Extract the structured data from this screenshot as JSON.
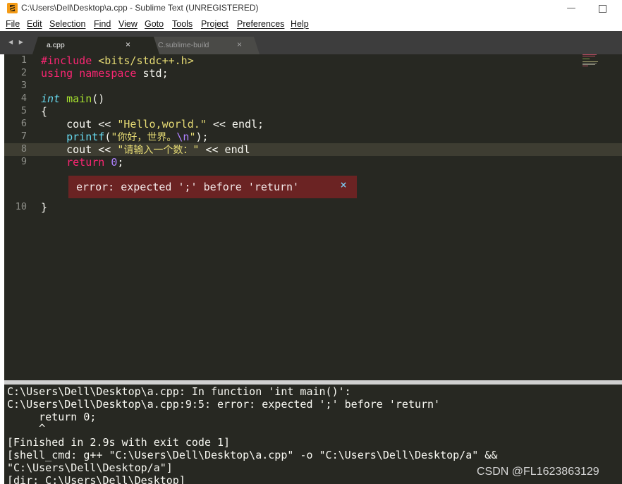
{
  "window": {
    "title": "C:\\Users\\Dell\\Desktop\\a.cpp - Sublime Text (UNREGISTERED)",
    "minimize_glyph": "—"
  },
  "menu": [
    "File",
    "Edit",
    "Selection",
    "Find",
    "View",
    "Goto",
    "Tools",
    "Project",
    "Preferences",
    "Help"
  ],
  "tabs": [
    {
      "label": "a.cpp",
      "active": true,
      "close": "×"
    },
    {
      "label": "C.sublime-build",
      "active": false,
      "close": "×"
    }
  ],
  "nav_arrows": "◀ ▶",
  "editor": {
    "line_numbers": [
      "1",
      "2",
      "3",
      "4",
      "5",
      "6",
      "7",
      "8",
      "9",
      "10"
    ],
    "highlighted_line": "8",
    "code": {
      "l1_directive": "#include",
      "l1_header": "<bits/stdc++.h>",
      "l2_using": "using",
      "l2_namespace": "namespace",
      "l2_rest": " std;",
      "l4_type": "int",
      "l4_fn": "main",
      "l4_rest": "()",
      "l5": "{",
      "l6_cout": "    cout << ",
      "l6_str": "\"Hello,world.\"",
      "l6_rest": " << endl;",
      "l7_indent": "    ",
      "l7_fn": "printf",
      "l7_open": "(",
      "l7_str_open": "\"",
      "l7_cjk": "你好，世界。",
      "l7_esc": "\\n",
      "l7_str_close": "\"",
      "l7_rest": ");",
      "l8_cout": "    cout << ",
      "l8_quote": "\"",
      "l8_cjk": "请输入一个数：",
      "l8_quote_close": "\"",
      "l8_rest": " << endl",
      "l9_indent": "    ",
      "l9_kw": "return",
      "l9_space": " ",
      "l9_num": "0",
      "l9_semi": ";",
      "l10": "}"
    },
    "error_message": "error: expected ';' before 'return'",
    "error_close": "×"
  },
  "console": {
    "lines": [
      "C:\\Users\\Dell\\Desktop\\a.cpp: In function 'int main()':",
      "C:\\Users\\Dell\\Desktop\\a.cpp:9:5: error: expected ';' before 'return'",
      "     return 0;",
      "     ^",
      "[Finished in 2.9s with exit code 1]",
      "[shell_cmd: g++ \"C:\\Users\\Dell\\Desktop\\a.cpp\" -o \"C:\\Users\\Dell\\Desktop/a\" &&",
      "\"C:\\Users\\Dell\\Desktop/a\"]",
      "[dir: C:\\Users\\Dell\\Desktop]"
    ]
  },
  "watermark": "CSDN @FL1623863129",
  "colors": {
    "editor_bg": "#272822",
    "keyword": "#f92672",
    "string": "#e6db74",
    "type": "#66d9ef",
    "function": "#a6e22e",
    "number": "#ae81ff",
    "error_bg": "#6b2323"
  }
}
